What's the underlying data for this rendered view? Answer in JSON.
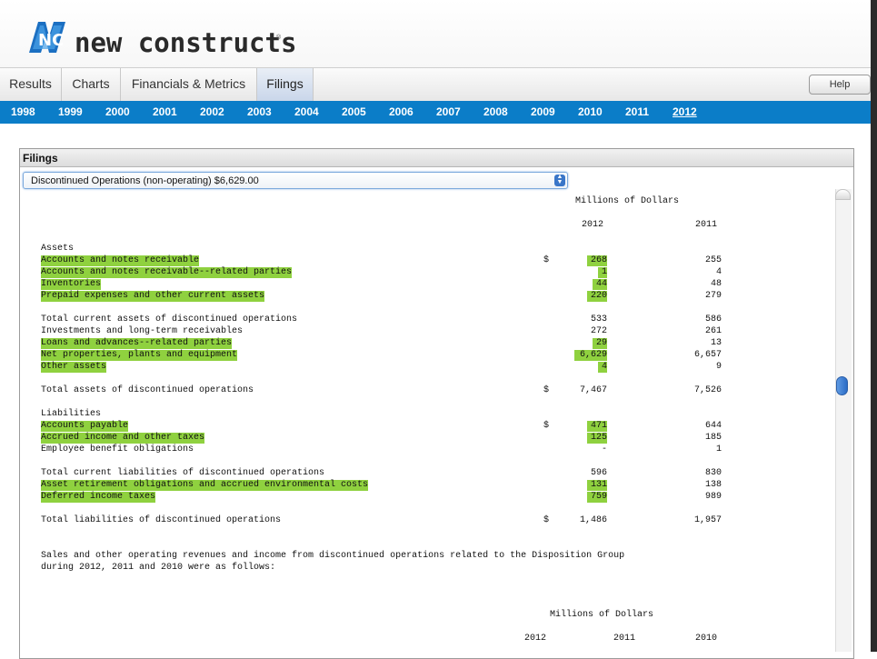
{
  "brand": {
    "name": "new constructs",
    "reg": "®",
    "mark": "NC"
  },
  "tabs": [
    {
      "label": "Results"
    },
    {
      "label": "Charts"
    },
    {
      "label": "Financials & Metrics"
    },
    {
      "label": "Filings",
      "active": true
    }
  ],
  "help_label": "Help",
  "years": [
    "1998",
    "1999",
    "2000",
    "2001",
    "2002",
    "2003",
    "2004",
    "2005",
    "2006",
    "2007",
    "2008",
    "2009",
    "2010",
    "2011",
    "2012"
  ],
  "selected_year": "2012",
  "panel": {
    "title": "Filings",
    "select_value": "Discontinued Operations (non-operating) $6,629.00"
  },
  "filing": {
    "units_header": "Millions of Dollars",
    "col_2012": "2012",
    "col_2011": "2011",
    "dollar": "$",
    "dash": "-",
    "assets_label": "Assets",
    "assets": [
      {
        "label": "Accounts and notes receivable",
        "v2012": "268",
        "v2011": "255",
        "hl": true,
        "dollar": true
      },
      {
        "label": "Accounts and notes receivable--related parties",
        "v2012": "1",
        "v2011": "4",
        "hl": true
      },
      {
        "label": "Inventories",
        "v2012": "44",
        "v2011": "48",
        "hl": true
      },
      {
        "label": "Prepaid expenses and other current assets",
        "v2012": "220",
        "v2011": "279",
        "hl": true
      }
    ],
    "assets2": [
      {
        "label": "Total current assets of discontinued operations",
        "v2012": "533",
        "v2011": "586",
        "hl": false
      },
      {
        "label": "Investments and long-term receivables",
        "v2012": "272",
        "v2011": "261",
        "hl": false
      },
      {
        "label": "Loans and advances--related parties",
        "v2012": "29",
        "v2011": "13",
        "hl": true
      },
      {
        "label": "Net properties, plants and equipment",
        "v2012": "6,629",
        "v2011": "6,657",
        "hl": true
      },
      {
        "label": "Other assets",
        "v2012": "4",
        "v2011": "9",
        "hl": true
      }
    ],
    "total_assets": {
      "label": "Total assets of discontinued operations",
      "v2012": "7,467",
      "v2011": "7,526"
    },
    "liabilities_label": "Liabilities",
    "liabilities": [
      {
        "label": "Accounts payable",
        "v2012": "471",
        "v2011": "644",
        "hl": true,
        "dollar": true
      },
      {
        "label": "Accrued income and other taxes",
        "v2012": "125",
        "v2011": "185",
        "hl": true
      },
      {
        "label": "Employee benefit obligations",
        "v2012": "-",
        "v2011": "1",
        "hl": false
      }
    ],
    "liabilities2": [
      {
        "label": "Total current liabilities of discontinued operations",
        "v2012": "596",
        "v2011": "830",
        "hl": false
      },
      {
        "label": "Asset retirement obligations and accrued environmental costs",
        "v2012": "131",
        "v2011": "138",
        "hl": true
      },
      {
        "label": "Deferred income taxes",
        "v2012": "759",
        "v2011": "989",
        "hl": true
      }
    ],
    "total_liabilities": {
      "label": "Total liabilities of discontinued operations",
      "v2012": "1,486",
      "v2011": "1,957"
    },
    "narrative_line1": "Sales and other operating revenues and income from discontinued operations related to the Disposition Group",
    "narrative_line2": "during 2012, 2011 and 2010 were as follows:",
    "units_header2": "Millions of Dollars",
    "col2_2012": "2012",
    "col2_2011": "2011",
    "col2_2010": "2010"
  }
}
